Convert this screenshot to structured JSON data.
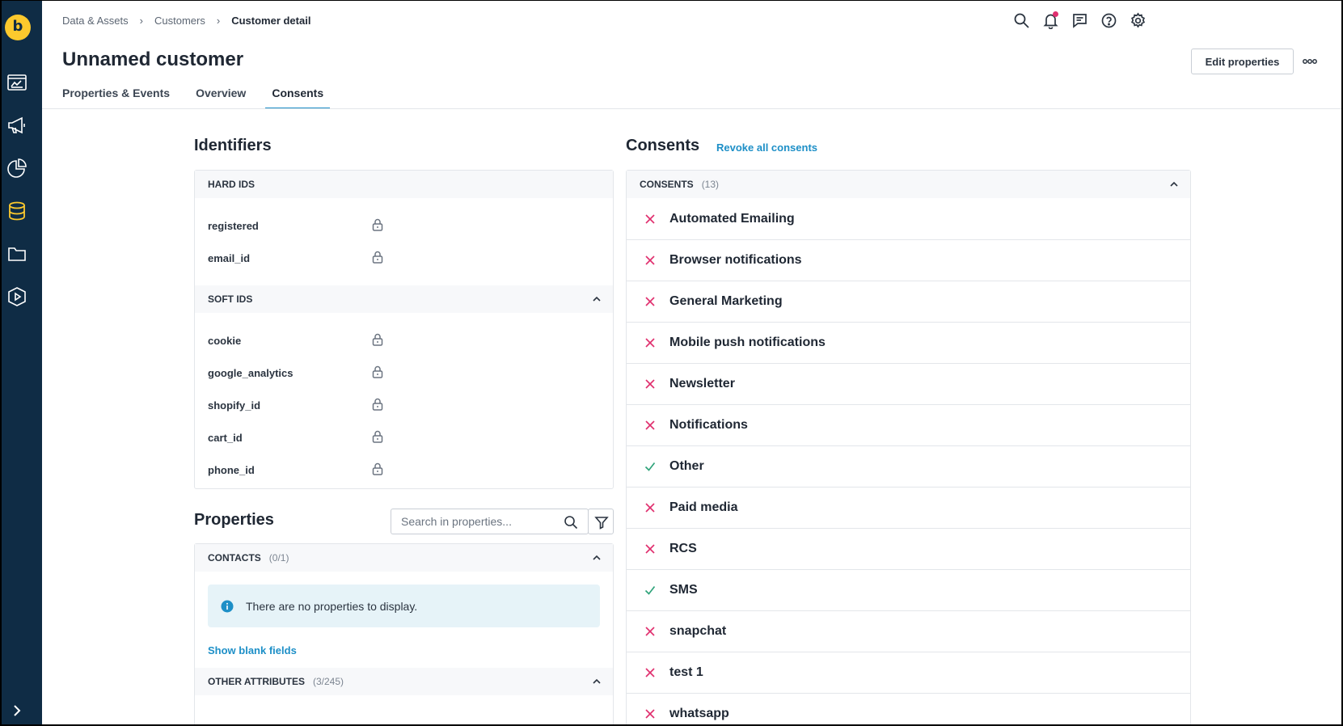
{
  "app": {
    "logo_letter": "b"
  },
  "sidebar": {
    "items": [
      {
        "icon": "dashboard-icon"
      },
      {
        "icon": "megaphone-icon"
      },
      {
        "icon": "pie-chart-icon"
      },
      {
        "icon": "database-icon",
        "active": true
      },
      {
        "icon": "folder-icon"
      },
      {
        "icon": "play-circle-icon"
      }
    ],
    "expand_icon": "chevron-right-icon"
  },
  "breadcrumb": [
    "Data & Assets",
    "Customers",
    "Customer detail"
  ],
  "header": {
    "icons": [
      "search-icon",
      "bell-icon",
      "chat-icon",
      "help-icon",
      "gear-icon"
    ],
    "title": "Unnamed customer",
    "edit_label": "Edit properties"
  },
  "tabs": [
    {
      "label": "Properties & Events",
      "active": false
    },
    {
      "label": "Overview",
      "active": false
    },
    {
      "label": "Consents",
      "active": true
    }
  ],
  "identifiers": {
    "title": "Identifiers",
    "hard_label": "HARD IDS",
    "hard_ids": [
      "registered",
      "email_id"
    ],
    "soft_label": "SOFT IDS",
    "soft_ids": [
      "cookie",
      "google_analytics",
      "shopify_id",
      "cart_id",
      "phone_id"
    ]
  },
  "properties": {
    "title": "Properties",
    "search_placeholder": "Search in properties...",
    "contacts_label": "CONTACTS",
    "contacts_count": "(0/1)",
    "empty_message": "There are no properties to display.",
    "show_blank": "Show blank fields",
    "other_label": "OTHER ATTRIBUTES",
    "other_count": "(3/245)"
  },
  "consents": {
    "title": "Consents",
    "revoke_label": "Revoke all consents",
    "section_label": "CONSENTS",
    "count": "(13)",
    "items": [
      {
        "label": "Automated Emailing",
        "granted": false
      },
      {
        "label": "Browser notifications",
        "granted": false
      },
      {
        "label": "General Marketing",
        "granted": false
      },
      {
        "label": "Mobile push notifications",
        "granted": false
      },
      {
        "label": "Newsletter",
        "granted": false
      },
      {
        "label": "Notifications",
        "granted": false
      },
      {
        "label": "Other",
        "granted": true
      },
      {
        "label": "Paid media",
        "granted": false
      },
      {
        "label": "RCS",
        "granted": false
      },
      {
        "label": "SMS",
        "granted": true
      },
      {
        "label": "snapchat",
        "granted": false
      },
      {
        "label": "test 1",
        "granted": false
      },
      {
        "label": "whatsapp",
        "granted": false
      }
    ]
  },
  "colors": {
    "sidebar_bg": "#0f2c45",
    "logo": "#fcc92d",
    "accent": "#1d8fc7",
    "denied": "#e0306f",
    "granted": "#2fa37a"
  }
}
